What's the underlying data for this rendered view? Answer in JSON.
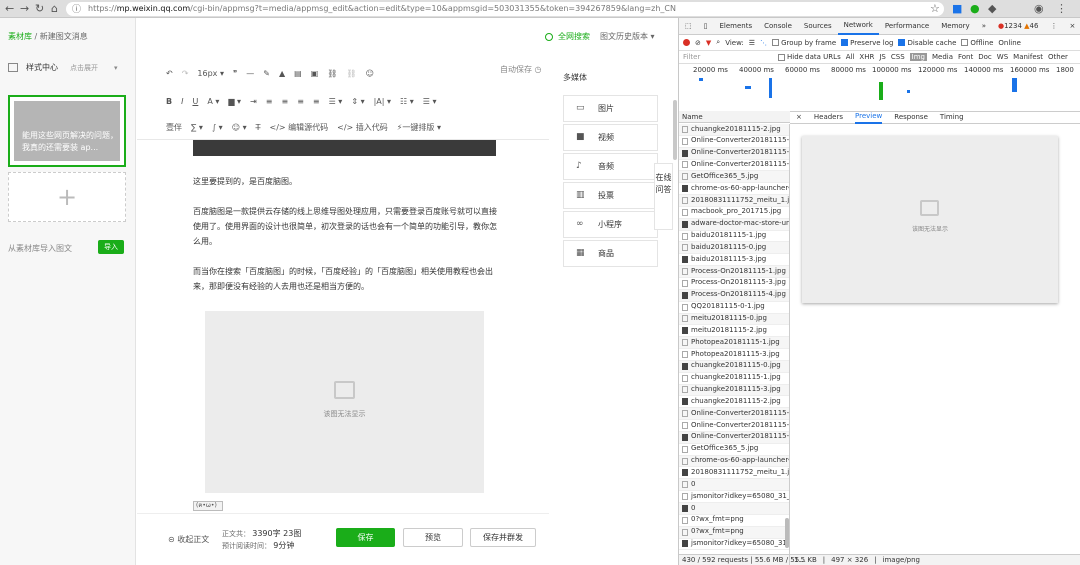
{
  "browser": {
    "url_prefix": "https://",
    "url_host": "mp.weixin.qq.com",
    "url_rest": "/cgi-bin/appmsg?t=media/appmsg_edit&action=edit&type=10&appmsgid=503031355&token=394267859&lang=zh_CN"
  },
  "breadcrumb": {
    "root": "素材库",
    "sep": "/",
    "current": "新建图文消息"
  },
  "left": {
    "style_center": "样式中心",
    "expand": "点击展开",
    "article_title": "能用这些网页解决的问题，我真的还需要装 ap...",
    "import_label": "从素材库导入图文",
    "import_button": "导入"
  },
  "header": {
    "search": "全网搜索",
    "history": "图文历史版本"
  },
  "toolbar": {
    "font_size": "16px",
    "autosave": "自动保存",
    "row3": [
      "壹伴",
      "编辑源代码",
      "插入代码",
      "一键排版"
    ]
  },
  "article": {
    "p1": "这里要提到的，是百度脑图。",
    "p2": "百度脑图是一款提供云存储的线上思维导图处理应用，只需要登录百度账号就可以直接使用了。使用界面的设计也很简单，初次登录的话也会有一个简单的功能引导，教你怎么用。",
    "p3": "而当你在搜索「百度脑图」的时候，「百度经验」的「百度脑图」相关使用教程也会出来，那即便没有经验的人去用也还是相当方便的。",
    "img_caption": "该图无法显示",
    "badge": "(ฅ•ω•)"
  },
  "footer": {
    "collapse": "收起正文",
    "words_label": "正文共：",
    "words_value": "3390字 23图",
    "read_label": "预计阅读时间：",
    "read_value": "9分钟",
    "save": "保存",
    "preview": "预览",
    "save_send": "保存并群发"
  },
  "media": {
    "title": "多媒体",
    "items": [
      {
        "label": "图片",
        "icon": "image-icon"
      },
      {
        "label": "视频",
        "icon": "video-icon"
      },
      {
        "label": "音频",
        "icon": "microphone-icon"
      },
      {
        "label": "投票",
        "icon": "bar-chart-icon"
      },
      {
        "label": "小程序",
        "icon": "mini-program-icon"
      },
      {
        "label": "商品",
        "icon": "goods-icon"
      }
    ],
    "online_qa": "在线问答"
  },
  "devtools": {
    "tabs": [
      "Elements",
      "Console",
      "Sources",
      "Network",
      "Performance",
      "Memory",
      "»"
    ],
    "active_tab": "Network",
    "errors": "1234",
    "warnings": "46",
    "toolbar": {
      "view": "View:",
      "group": "Group by frame",
      "preserve": "Preserve log",
      "cache": "Disable cache",
      "offline": "Offline",
      "online": "Online"
    },
    "filter": {
      "placeholder": "Filter",
      "hide": "Hide data URLs",
      "types": [
        "All",
        "XHR",
        "JS",
        "CSS",
        "Img",
        "Media",
        "Font",
        "Doc",
        "WS",
        "Manifest",
        "Other"
      ]
    },
    "ticks": [
      "20000 ms",
      "40000 ms",
      "60000 ms",
      "80000 ms",
      "100000 ms",
      "120000 ms",
      "140000 ms",
      "160000 ms",
      "1800"
    ],
    "name_header": "Name",
    "requests": [
      "chuangke20181115-2.jpg",
      "Online-Converter20181115-1.",
      "Online-Converter20181115-2.",
      "Online-Converter20181115-3.",
      "GetOffice365_5.jpg",
      "chrome-os-60-app-launcher-.",
      "20180831111752_meitu_1.jpg",
      "macbook_pro_201715.jpg",
      "adware-doctor-mac-store-un.",
      "baidu20181115-1.jpg",
      "baidu20181115-0.jpg",
      "baidu20181115-3.jpg",
      "Process-On20181115-1.jpg",
      "Process-On20181115-3.jpg",
      "Process-On20181115-4.jpg",
      "QQ20181115-0-1.jpg",
      "meitu20181115-0.jpg",
      "meitu20181115-2.jpg",
      "Photopea20181115-1.jpg",
      "Photopea20181115-3.jpg",
      "chuangke20181115-0.jpg",
      "chuangke20181115-1.jpg",
      "chuangke20181115-3.jpg",
      "chuangke20181115-2.jpg",
      "Online-Converter20181115-1.",
      "Online-Converter20181115-2.",
      "Online-Converter20181115-3.",
      "GetOffice365_5.jpg",
      "chrome-os-60-app-launcher-.",
      "20180831111752_meitu_1.jpg",
      "0",
      "jsmonitor?idkey=65080_31_1.",
      "0",
      "0?wx_fmt=png",
      "0?wx_fmt=png",
      "jsmonitor?idkey=65080_31_1."
    ],
    "detail_tabs": [
      "×",
      "Headers",
      "Preview",
      "Response",
      "Timing"
    ],
    "active_detail": "Preview",
    "preview_caption": "该图无法显示",
    "status": {
      "requests": "430 / 592 requests | 55.6 MB / 55...",
      "size": "1.5 KB",
      "dims": "497 × 326",
      "type": "image/png"
    }
  }
}
